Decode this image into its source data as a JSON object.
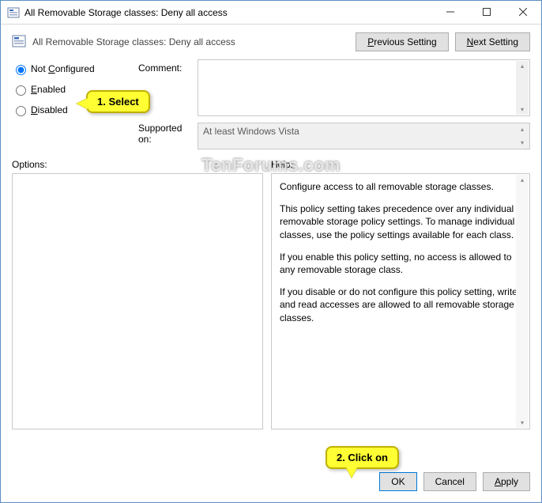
{
  "window": {
    "title": "All Removable Storage classes: Deny all access"
  },
  "header": {
    "policy_title": "All Removable Storage classes: Deny all access",
    "prev_btn": "Previous Setting",
    "next_btn": "Next Setting"
  },
  "radios": {
    "not_configured": "Not Configured",
    "enabled": "Enabled",
    "disabled": "Disabled",
    "selected": "not_configured"
  },
  "labels": {
    "comment": "Comment:",
    "supported": "Supported on:",
    "options": "Options:",
    "help": "Help:"
  },
  "supported_on": "At least Windows Vista",
  "help": {
    "p1": "Configure access to all removable storage classes.",
    "p2": "This policy setting takes precedence over any individual removable storage policy settings. To manage individual classes, use the policy settings available for each class.",
    "p3": "If you enable this policy setting, no access is allowed to any removable storage class.",
    "p4": "If you disable or do not configure this policy setting, write and read accesses are allowed to all removable storage classes."
  },
  "buttons": {
    "ok": "OK",
    "cancel": "Cancel",
    "apply": "Apply"
  },
  "callouts": {
    "c1": "1. Select",
    "c2": "2. Click on"
  },
  "watermark": "TenForums.com"
}
